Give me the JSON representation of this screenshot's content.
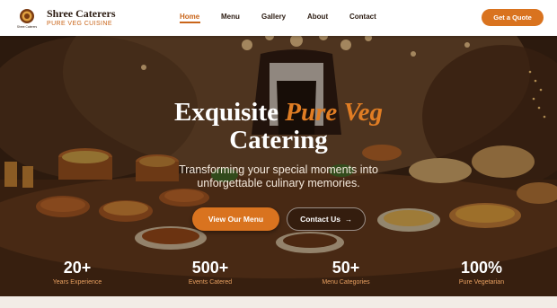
{
  "brand": {
    "name": "Shree Caterers",
    "tagline": "PURE VEG CUISINE",
    "logo_text": "Shree Caterers"
  },
  "nav": {
    "items": [
      {
        "label": "Home",
        "active": true
      },
      {
        "label": "Menu",
        "active": false
      },
      {
        "label": "Gallery",
        "active": false
      },
      {
        "label": "About",
        "active": false
      },
      {
        "label": "Contact",
        "active": false
      }
    ],
    "cta_label": "Get a Quote"
  },
  "hero": {
    "title_part1": "Exquisite ",
    "title_accent": "Pure Veg",
    "title_line2": "Catering",
    "subtitle_line1": "Transforming your special moments into",
    "subtitle_line2": "unforgettable culinary memories.",
    "primary_button": "View Our Menu",
    "secondary_button": "Contact Us",
    "secondary_icon": "arrow-right-icon"
  },
  "stats": [
    {
      "value": "20+",
      "label": "Years Experience"
    },
    {
      "value": "500+",
      "label": "Events Catered"
    },
    {
      "value": "50+",
      "label": "Menu Categories"
    },
    {
      "value": "100%",
      "label": "Pure Vegetarian"
    }
  ],
  "colors": {
    "accent": "#d9731f",
    "brand_text": "#2a1a10",
    "stat_label": "#e8a060"
  }
}
